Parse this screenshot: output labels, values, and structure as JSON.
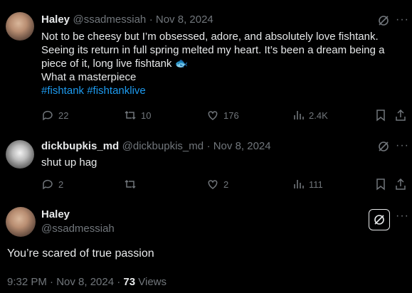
{
  "tweet1": {
    "name": "Haley",
    "handle": "@ssadmessiah",
    "date": "· Nov 8, 2024",
    "lines": [
      "Not to be cheesy but I’m obsessed, adore, and absolutely love fishtank.",
      "Seeing its return in full spring melted my heart. It’s been a dream being a",
      "piece of it, long live fishtank 🐟",
      "What a masterpiece"
    ],
    "hashtags": [
      "#fishtank",
      "#fishtanklive"
    ],
    "stats": {
      "replies": "22",
      "reposts": "10",
      "likes": "176",
      "views": "2.4K"
    }
  },
  "tweet2": {
    "name": "dickbupkis_md",
    "handle": "@dickbupkis_md",
    "date": "· Nov 8, 2024",
    "text": "shut up hag",
    "stats": {
      "replies": "2",
      "reposts": "",
      "likes": "2",
      "views": "111"
    }
  },
  "tweet3": {
    "name": "Haley",
    "handle": "@ssadmessiah",
    "text": "You’re scared of true passion",
    "time": "9:32 PM · Nov 8, 2024 · ",
    "views_count": "73",
    "views_label": " Views"
  },
  "icons": [
    "grok-icon",
    "more-icon",
    "reply-icon",
    "repost-icon",
    "like-icon",
    "views-icon",
    "bookmark-icon",
    "share-icon"
  ],
  "colors": {
    "background": "#000000",
    "text": "#e7e9ea",
    "muted": "#71767b",
    "link": "#1d9bf0"
  }
}
